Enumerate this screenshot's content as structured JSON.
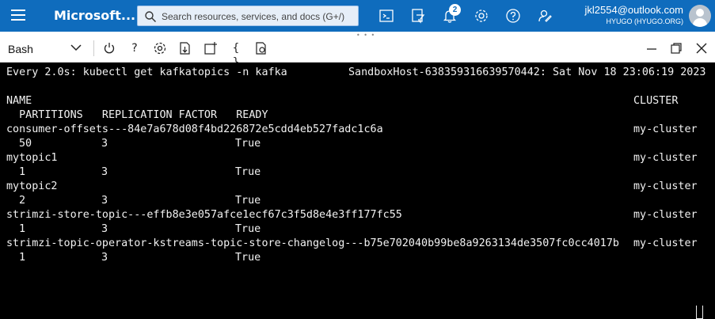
{
  "topbar": {
    "brand": "Microsoft...",
    "search_placeholder": "Search resources, services, and docs (G+/)",
    "notifications_count": "2",
    "account_email": "jkl2554@outlook.com",
    "account_directory": "HYUGO (HYUGO.ORG)",
    "icons": [
      "cloud-shell-icon",
      "directory-filter-icon",
      "notifications-icon",
      "settings-icon",
      "help-icon",
      "feedback-icon"
    ]
  },
  "shell_toolbar": {
    "shell_type": "Bash",
    "buttons": [
      "power-icon",
      "help-icon",
      "settings-icon",
      "upload-download-icon",
      "new-session-icon",
      "editor-icon",
      "web-preview-icon"
    ],
    "window_buttons": [
      "minimize-icon",
      "maximize-icon",
      "close-icon"
    ]
  },
  "terminal": {
    "header_left": "Every 2.0s: kubectl get kafkatopics -n kafka",
    "header_right": "SandboxHost-638359316639570442: Sat Nov 18 23:06:19 2023",
    "col_name": "NAME",
    "col_cluster": "CLUSTER",
    "subheader": "  PARTITIONS   REPLICATION FACTOR   READY",
    "rows": [
      {
        "name": "consumer-offsets---84e7a678d08f4bd226872e5cdd4eb527fadc1c6a",
        "cluster": "my-cluster",
        "partitions": "50",
        "replication": "3",
        "ready": "True"
      },
      {
        "name": "mytopic1",
        "cluster": "my-cluster",
        "partitions": "1",
        "replication": "3",
        "ready": "True"
      },
      {
        "name": "mytopic2",
        "cluster": "my-cluster",
        "partitions": "2",
        "replication": "3",
        "ready": "True"
      },
      {
        "name": "strimzi-store-topic---effb8e3e057afce1ecf67c3f5d8e4e3ff177fc55",
        "cluster": "my-cluster",
        "partitions": "1",
        "replication": "3",
        "ready": "True"
      },
      {
        "name": "strimzi-topic-operator-kstreams-topic-store-changelog---b75e702040b99be8a9263134de3507fc0cc4017b",
        "cluster": "my-cluster",
        "partitions": "1",
        "replication": "3",
        "ready": "True"
      }
    ]
  }
}
